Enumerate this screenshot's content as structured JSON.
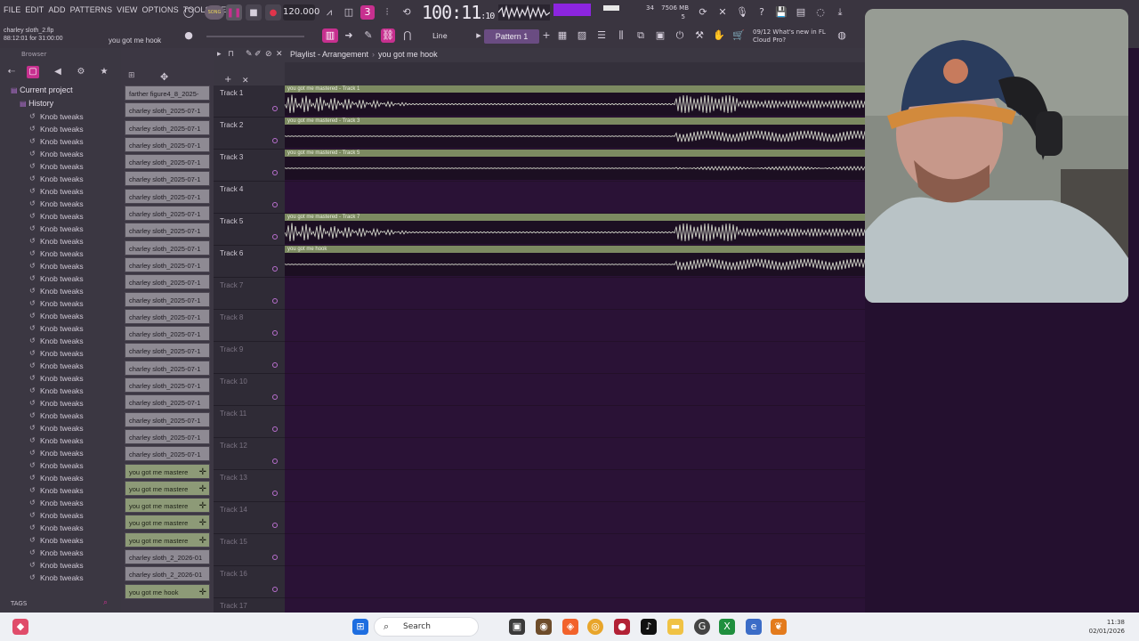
{
  "menu": [
    "FILE",
    "EDIT",
    "ADD",
    "PATTERNS",
    "VIEW",
    "OPTIONS",
    "TOOLS",
    "HELP"
  ],
  "project": {
    "filename": "charley sloth_2.flp",
    "position": "88:12:01 for 31:00:00",
    "hint": "you got me  hook"
  },
  "transport": {
    "mode": "SONG",
    "tempo": "120.000",
    "time_main": "100:11",
    "time_sub": ":10",
    "snap": "Line",
    "pattern": "Pattern 1",
    "mem": "7506 MB",
    "poly_top": "34",
    "poly_bottom": "5",
    "cpu_label": "8 ST"
  },
  "news": {
    "date": "09/12",
    "line1": "What's new in FL",
    "line2": "Cloud Pro?"
  },
  "browser": {
    "title": "Browser",
    "current_project": "Current project",
    "history": "History",
    "history_items": [
      "Knob tweaks",
      "Knob tweaks",
      "Knob tweaks",
      "Knob tweaks",
      "Knob tweaks",
      "Knob tweaks",
      "Knob tweaks",
      "Knob tweaks",
      "Knob tweaks",
      "Knob tweaks",
      "Knob tweaks",
      "Knob tweaks",
      "Knob tweaks",
      "Knob tweaks",
      "Knob tweaks",
      "Knob tweaks",
      "Knob tweaks",
      "Knob tweaks",
      "Knob tweaks",
      "Knob tweaks",
      "Knob tweaks",
      "Knob tweaks",
      "Knob tweaks",
      "Knob tweaks",
      "Knob tweaks",
      "Knob tweaks",
      "Knob tweaks",
      "Knob tweaks",
      "Knob tweaks",
      "Knob tweaks",
      "Knob tweaks",
      "Knob tweaks",
      "Knob tweaks",
      "Knob tweaks",
      "Knob tweaks",
      "Knob tweaks",
      "Knob tweaks",
      "Knob tweaks"
    ],
    "tags_label": "TAGS"
  },
  "picker": {
    "clips": [
      {
        "name": "farther figure4_8_2025-",
        "kind": "pattern"
      },
      {
        "name": "charley sloth_2025-07-1",
        "kind": "pattern"
      },
      {
        "name": "charley sloth_2025-07-1",
        "kind": "pattern"
      },
      {
        "name": "charley sloth_2025-07-1",
        "kind": "pattern"
      },
      {
        "name": "charley sloth_2025-07-1",
        "kind": "pattern"
      },
      {
        "name": "charley sloth_2025-07-1",
        "kind": "pattern"
      },
      {
        "name": "charley sloth_2025-07-1",
        "kind": "pattern"
      },
      {
        "name": "charley sloth_2025-07-1",
        "kind": "pattern"
      },
      {
        "name": "charley sloth_2025-07-1",
        "kind": "pattern"
      },
      {
        "name": "charley sloth_2025-07-1",
        "kind": "pattern"
      },
      {
        "name": "charley sloth_2025-07-1",
        "kind": "pattern"
      },
      {
        "name": "charley sloth_2025-07-1",
        "kind": "pattern"
      },
      {
        "name": "charley sloth_2025-07-1",
        "kind": "pattern"
      },
      {
        "name": "charley sloth_2025-07-1",
        "kind": "pattern"
      },
      {
        "name": "charley sloth_2025-07-1",
        "kind": "pattern"
      },
      {
        "name": "charley sloth_2025-07-1",
        "kind": "pattern"
      },
      {
        "name": "charley sloth_2025-07-1",
        "kind": "pattern"
      },
      {
        "name": "charley sloth_2025-07-1",
        "kind": "pattern"
      },
      {
        "name": "charley sloth_2025-07-1",
        "kind": "pattern"
      },
      {
        "name": "charley sloth_2025-07-1",
        "kind": "pattern"
      },
      {
        "name": "charley sloth_2025-07-1",
        "kind": "pattern"
      },
      {
        "name": "charley sloth_2025-07-1",
        "kind": "pattern"
      },
      {
        "name": "you got me mastere",
        "kind": "audio"
      },
      {
        "name": "you got me mastere",
        "kind": "audio"
      },
      {
        "name": "you got me mastere",
        "kind": "audio"
      },
      {
        "name": "you got me mastere",
        "kind": "audio"
      },
      {
        "name": "you got me mastere",
        "kind": "audio"
      },
      {
        "name": "charley sloth_2_2026-01",
        "kind": "pattern"
      },
      {
        "name": "charley sloth_2_2026-01",
        "kind": "pattern"
      },
      {
        "name": "you got me  hook",
        "kind": "audio"
      }
    ]
  },
  "playlist": {
    "title": "Playlist - Arrangement",
    "current_clip": "you got me  hook",
    "tracks": [
      "Track 1",
      "Track 2",
      "Track 3",
      "Track 4",
      "Track 5",
      "Track 6",
      "Track 7",
      "Track 8",
      "Track 9",
      "Track 10",
      "Track 11",
      "Track 12",
      "Track 13",
      "Track 14",
      "Track 15",
      "Track 16",
      "Track 17"
    ],
    "clips": [
      {
        "track": 0,
        "label": "you got me mastered - Track 1",
        "style": "full"
      },
      {
        "track": 1,
        "label": "you got me mastered - Track 3",
        "style": "late"
      },
      {
        "track": 2,
        "label": "you got me mastered - Track 5",
        "style": "sparse"
      },
      {
        "track": 4,
        "label": "you got me mastered - Track 7",
        "style": "full"
      },
      {
        "track": 5,
        "label": "you got me  hook",
        "style": "late"
      }
    ]
  },
  "taskbar": {
    "search_placeholder": "Search",
    "time": "11:38",
    "date": "02/01/2026"
  },
  "colors": {
    "accent_pink": "#c7308f",
    "clip_green": "#7c8a61",
    "playlist_bg": "#26102f"
  }
}
